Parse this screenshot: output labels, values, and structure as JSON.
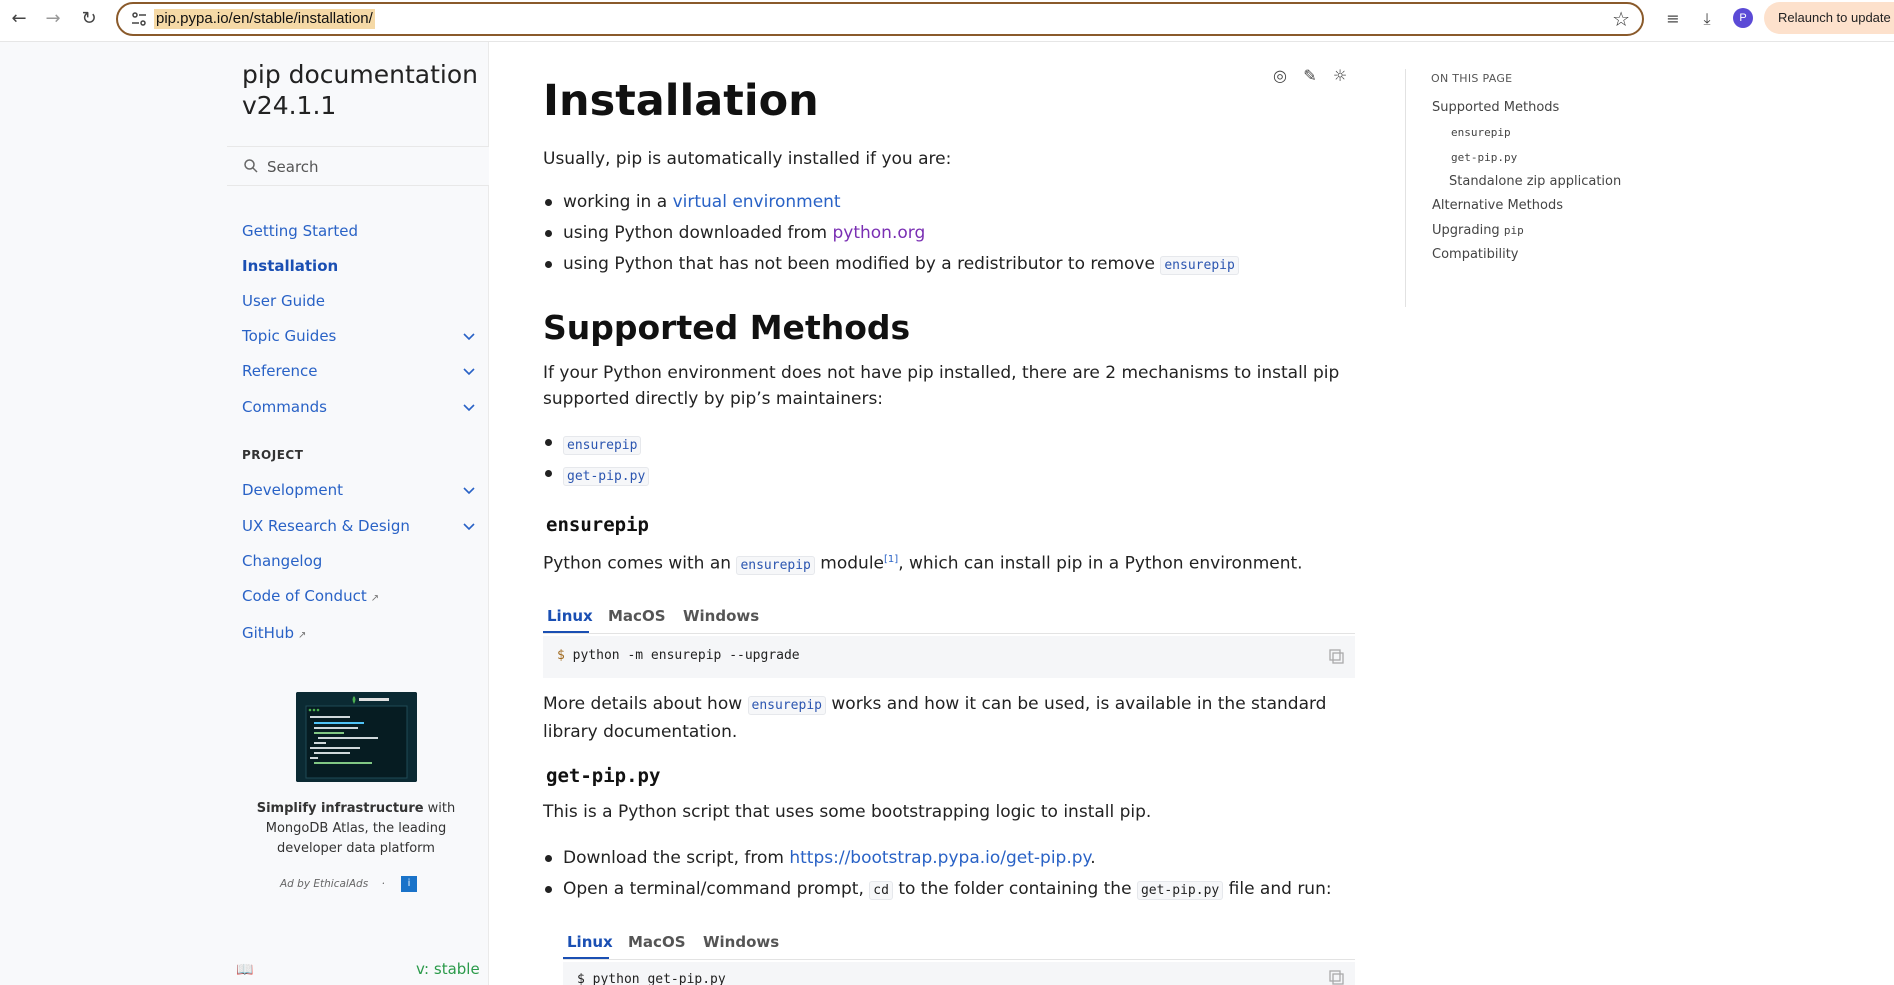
{
  "browser": {
    "url": "pip.pypa.io/en/stable/installation/",
    "avatar_letter": "P",
    "relaunch_label": "Relaunch to update"
  },
  "sidebar": {
    "brand_line1": "pip documentation",
    "brand_line2": "v24.1.1",
    "search_placeholder": "Search",
    "items": [
      {
        "label": "Getting Started"
      },
      {
        "label": "Installation"
      },
      {
        "label": "User Guide"
      },
      {
        "label": "Topic Guides"
      },
      {
        "label": "Reference"
      },
      {
        "label": "Commands"
      }
    ],
    "project_heading": "PROJECT",
    "project_items": [
      {
        "label": "Development"
      },
      {
        "label": "UX Research & Design"
      },
      {
        "label": "Changelog"
      },
      {
        "label": "Code of Conduct"
      },
      {
        "label": "GitHub"
      }
    ],
    "ad": {
      "bold": "Simplify infrastructure",
      "rest": " with MongoDB Atlas, the leading developer data platform",
      "by": "Ad by EthicalAds",
      "dot": "·",
      "info": "i"
    },
    "version": "v: stable"
  },
  "main": {
    "title": "Installation",
    "intro": "Usually, pip is automatically installed if you are:",
    "bullets": {
      "b1_pre": "working in a ",
      "b1_link": "virtual environment",
      "b2_pre": "using Python downloaded from ",
      "b2_link": "python.org",
      "b3_pre": "using Python that has not been modified by a redistributor to remove ",
      "b3_code": "ensurepip"
    },
    "supported": {
      "heading": "Supported Methods",
      "para": "If your Python environment does not have pip installed, there are 2 mechanisms to install pip supported directly by pip’s maintainers:",
      "m1": "ensurepip",
      "m2": "get-pip.py"
    },
    "ensurepip": {
      "heading": "ensurepip",
      "p_pre": "Python comes with an ",
      "p_code": "ensurepip",
      "p_mid": " module",
      "p_sup": "[1]",
      "p_post": ", which can install pip in a Python environment.",
      "tabs": [
        "Linux",
        "MacOS",
        "Windows"
      ],
      "prompt": "$",
      "command": " python -m ensurepip --upgrade",
      "more_pre": "More details about how ",
      "more_code": "ensurepip",
      "more_post": " works and how it can be used, is available in the standard library documentation."
    },
    "getpip": {
      "heading": "get-pip.py",
      "para": "This is a Python script that uses some bootstrapping logic to install pip.",
      "s1_pre": "Download the script, from ",
      "s1_link": "https://bootstrap.pypa.io/get-pip.py",
      "s1_post": ".",
      "s2_pre": "Open a terminal/command prompt, ",
      "s2_code1": "cd",
      "s2_mid": " to the folder containing the ",
      "s2_code2": "get-pip.py",
      "s2_post": " file and run:",
      "tabs": [
        "Linux",
        "MacOS",
        "Windows"
      ],
      "command": "$ python get-pip.py"
    }
  },
  "toc": {
    "heading": "ON THIS PAGE",
    "items": [
      {
        "label": "Supported Methods"
      },
      {
        "label": "ensurepip"
      },
      {
        "label": "get-pip.py"
      },
      {
        "label": "Standalone zip application"
      },
      {
        "label": "Alternative Methods"
      },
      {
        "label": "Upgrading ",
        "code": "pip"
      },
      {
        "label": "Compatibility"
      }
    ]
  }
}
